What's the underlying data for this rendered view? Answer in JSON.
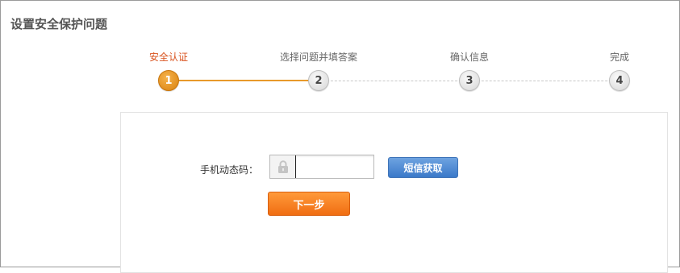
{
  "page": {
    "title": "设置安全保护问题"
  },
  "steps": [
    {
      "label": "安全认证",
      "number": "1",
      "state": "active"
    },
    {
      "label": "选择问题并填答案",
      "number": "2",
      "state": "pending"
    },
    {
      "label": "确认信息",
      "number": "3",
      "state": "pending"
    },
    {
      "label": "完成",
      "number": "4",
      "state": "pending"
    }
  ],
  "colors": {
    "active_step": "#d9531e",
    "progress_line": "#e89a2a",
    "sms_button": "#3b79c9",
    "next_button": "#f06d12"
  },
  "form": {
    "phone_code_label": "手机动态码：",
    "phone_code_value": "",
    "phone_code_placeholder": "",
    "lock_icon": "lock-icon",
    "sms_button_label": "短信获取",
    "next_button_label": "下一步"
  }
}
